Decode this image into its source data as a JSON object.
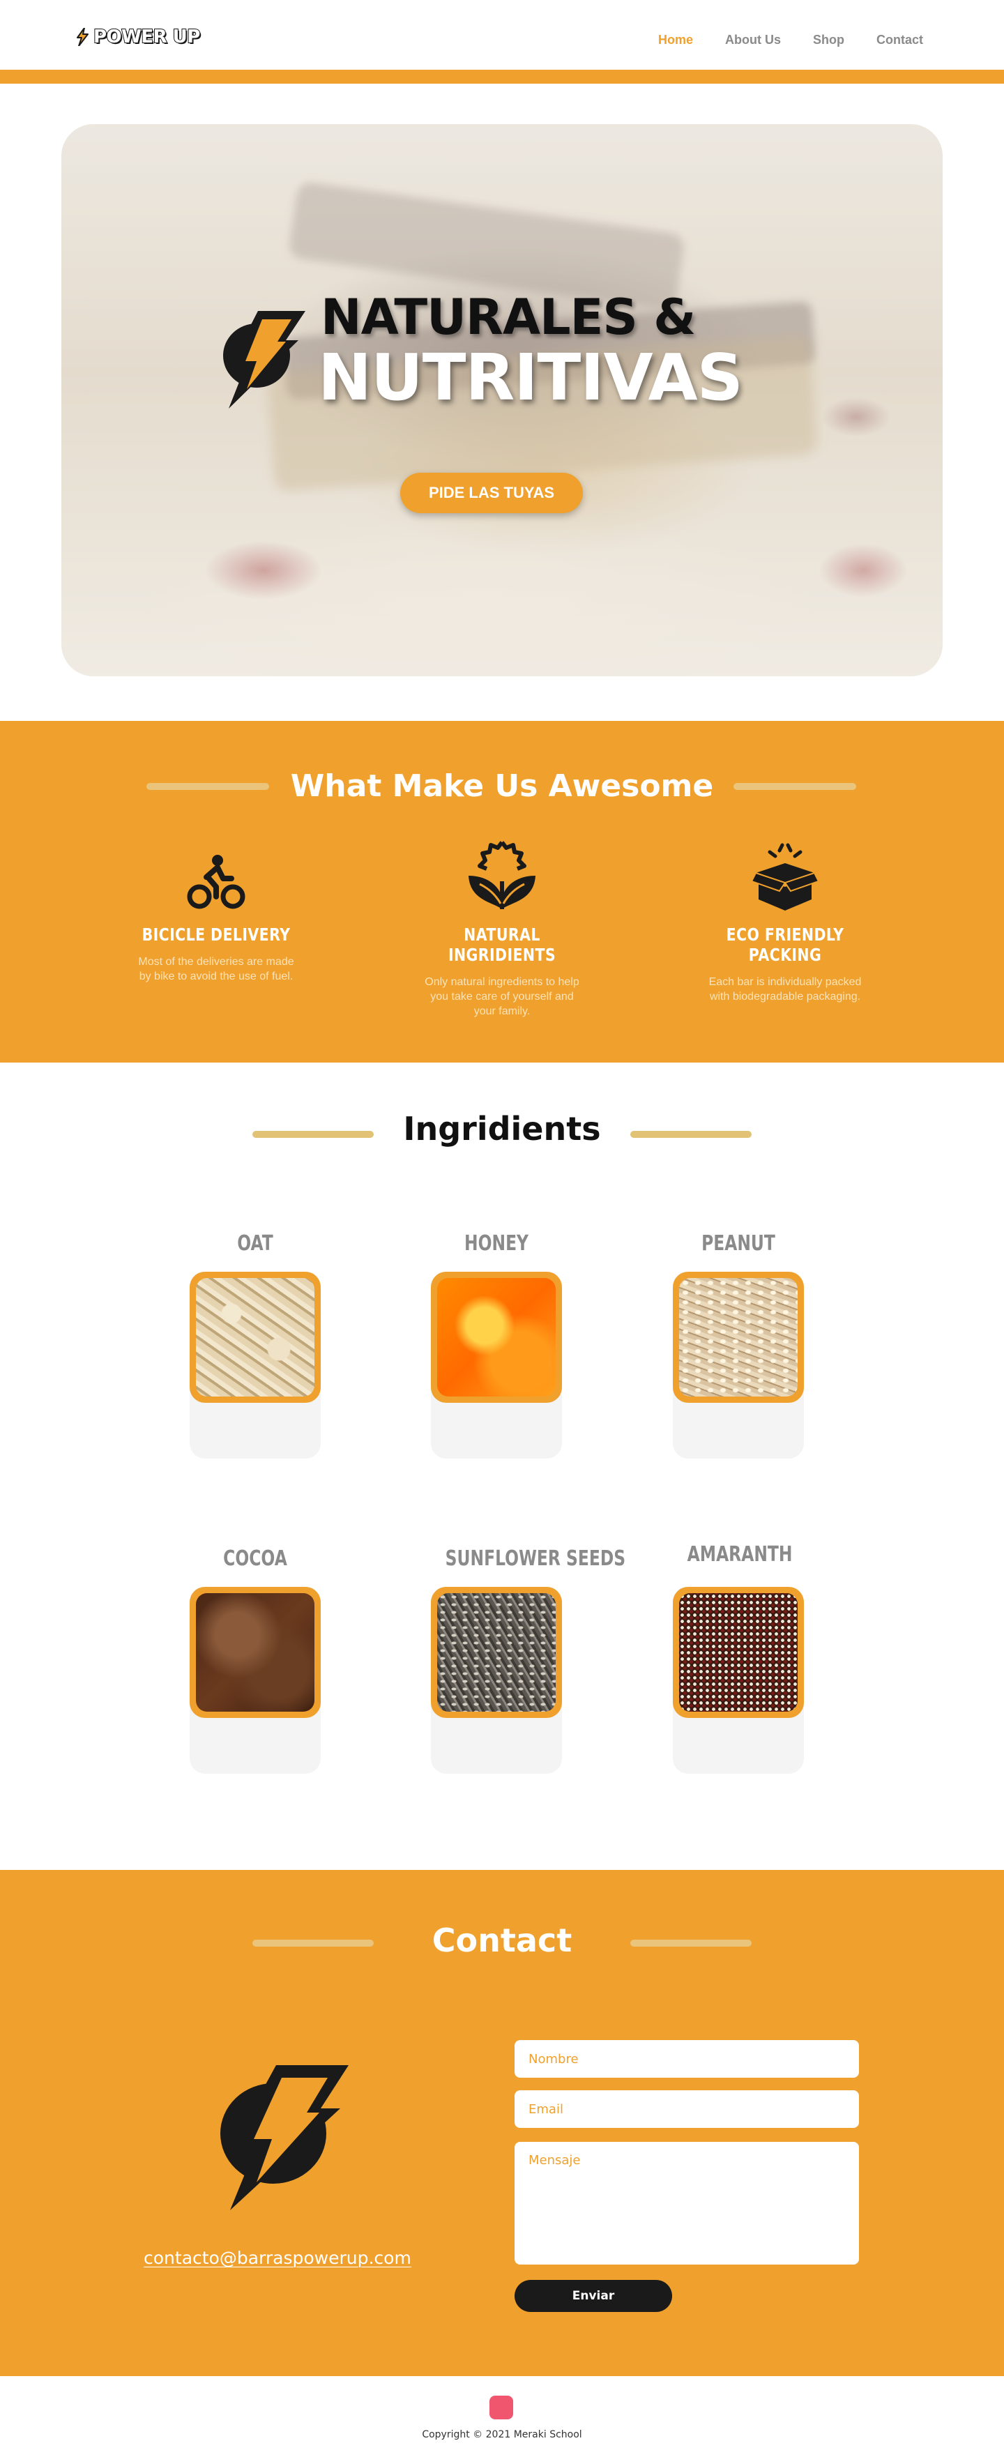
{
  "nav": {
    "brand": "POWER UP",
    "links": [
      "Home",
      "About Us",
      "Shop",
      "Contact"
    ],
    "active": "Home"
  },
  "hero": {
    "title_line1": "NATURALES &",
    "title_line2": "NUTRITIVAS",
    "cta": "PIDE LAS TUYAS"
  },
  "features": {
    "title": "What Make Us Awesome",
    "items": [
      {
        "icon": "bicycle-icon",
        "title": "BICICLE DELIVERY",
        "desc": "Most of the deliveries are made by bike to avoid the use of fuel."
      },
      {
        "icon": "leaf-gear-icon",
        "title": "NATURAL INGRIDIENTS",
        "desc": "Only natural ingredients to help you take care of yourself and your family."
      },
      {
        "icon": "box-icon",
        "title": "ECO FRIENDLY PACKING",
        "desc": "Each bar is individually packed with biodegradable packaging."
      }
    ]
  },
  "ingredients": {
    "title": "Ingridients",
    "items": [
      "OAT",
      "HONEY",
      "PEANUT",
      "COCOA",
      "SUNFLOWER SEEDS",
      "AMARANTH"
    ]
  },
  "contact": {
    "title": "Contact",
    "email": "contacto@barraspowerup.com",
    "name_placeholder": "Nombre",
    "email_placeholder": "Email",
    "message_placeholder": "Mensaje",
    "send": "Enviar"
  },
  "footer": {
    "social_icon": "instagram-icon",
    "copyright": "Copyright © 2021 Meraki School"
  },
  "colors": {
    "accent": "#f0a12d",
    "dark": "#1a1a1a",
    "social": "#f0576e"
  }
}
